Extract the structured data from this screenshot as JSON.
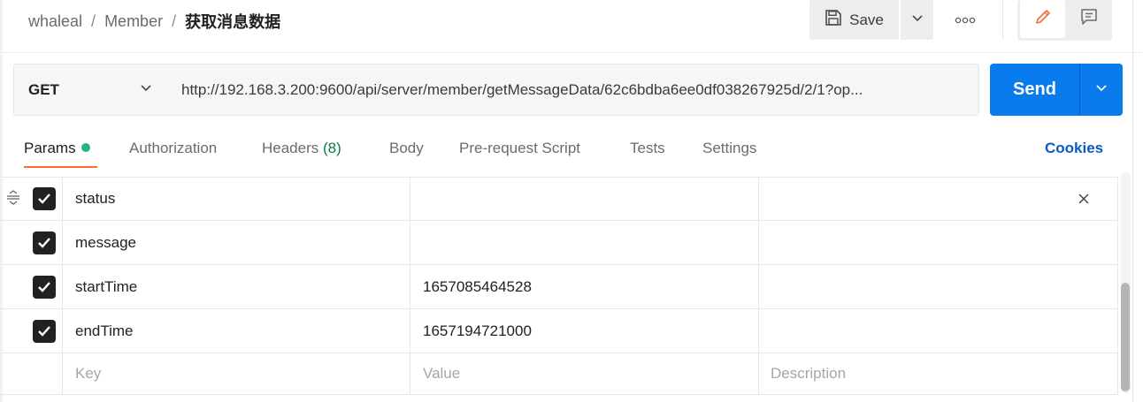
{
  "breadcrumb": {
    "workspace": "whaleal",
    "separator": "/",
    "collection": "Member",
    "request": "获取消息数据"
  },
  "toolbar": {
    "save_label": "Save",
    "save_icon": "floppy-disk-icon",
    "more_icon": "more-horizontal-icon",
    "edit_icon": "pencil-icon",
    "comment_icon": "comment-icon"
  },
  "request": {
    "method": "GET",
    "url": "http://192.168.3.200:9600/api/server/member/getMessageData/62c6bdba6ee0df038267925d/2/1?op...",
    "send_label": "Send"
  },
  "tabs": [
    {
      "label": "Params",
      "active": true,
      "has_dot": true
    },
    {
      "label": "Authorization",
      "active": false
    },
    {
      "label": "Headers",
      "count": "(8)",
      "active": false
    },
    {
      "label": "Body",
      "active": false
    },
    {
      "label": "Pre-request Script",
      "active": false
    },
    {
      "label": "Tests",
      "active": false
    },
    {
      "label": "Settings",
      "active": false
    }
  ],
  "cookies_label": "Cookies",
  "params": {
    "rows": [
      {
        "key": "status",
        "value": "",
        "description": "",
        "checked": true
      },
      {
        "key": "message",
        "value": "",
        "description": "",
        "checked": true
      },
      {
        "key": "startTime",
        "value": "1657085464528",
        "description": "",
        "checked": true
      },
      {
        "key": "endTime",
        "value": "1657194721000",
        "description": "",
        "checked": true
      }
    ],
    "placeholder": {
      "key": "Key",
      "value": "Value",
      "description": "Description"
    }
  },
  "colors": {
    "accent": "#ff6c37",
    "send": "#097bed",
    "cookies": "#0b5cc2",
    "params_dot": "#26b47f"
  }
}
